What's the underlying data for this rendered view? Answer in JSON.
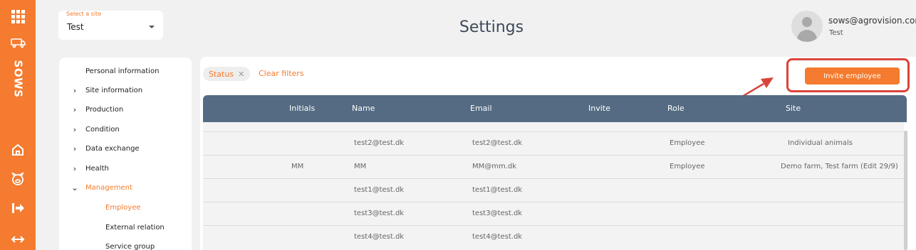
{
  "rail": {
    "brand": "SOWS",
    "icons": [
      "apps-grid-icon",
      "truck-icon",
      "home-icon",
      "pig-icon",
      "logout-icon",
      "swap-icon"
    ]
  },
  "site_select": {
    "label": "Select a site",
    "value": "Test"
  },
  "page_title": "Settings",
  "user": {
    "email": "sows@agrovision.com",
    "site": "Test"
  },
  "nav": {
    "items": [
      {
        "label": "Personal information",
        "chevron": ""
      },
      {
        "label": "Site information",
        "chevron": "right"
      },
      {
        "label": "Production",
        "chevron": "right"
      },
      {
        "label": "Condition",
        "chevron": "right"
      },
      {
        "label": "Data exchange",
        "chevron": "right"
      },
      {
        "label": "Health",
        "chevron": "right"
      },
      {
        "label": "Management",
        "chevron": "down"
      }
    ],
    "subitems": [
      {
        "label": "Employee"
      },
      {
        "label": "External relation"
      },
      {
        "label": "Service group"
      }
    ]
  },
  "filters": {
    "chip": "Status",
    "clear": "Clear filters"
  },
  "invite_button": "Invite employee",
  "table": {
    "columns": [
      "Initials",
      "Name",
      "Email",
      "Invite",
      "Role",
      "Site"
    ],
    "rows": [
      {
        "initials": "",
        "name": "test2@test.dk",
        "email": "test2@test.dk",
        "invite": "",
        "role": "Employee",
        "site": "Individual animals"
      },
      {
        "initials": "MM",
        "name": "MM",
        "email": "MM@mm.dk",
        "invite": "",
        "role": "Employee",
        "site": "Demo farm, Test farm (Edit 29/9)"
      },
      {
        "initials": "",
        "name": "test1@test.dk",
        "email": "test1@test.dk",
        "invite": "",
        "role": "",
        "site": ""
      },
      {
        "initials": "",
        "name": "test3@test.dk",
        "email": "test3@test.dk",
        "invite": "",
        "role": "",
        "site": ""
      },
      {
        "initials": "",
        "name": "test4@test.dk",
        "email": "test4@test.dk",
        "invite": "",
        "role": "",
        "site": ""
      }
    ]
  },
  "colors": {
    "accent": "#f47b2f",
    "header": "#546b83",
    "highlight": "#d9443a"
  }
}
